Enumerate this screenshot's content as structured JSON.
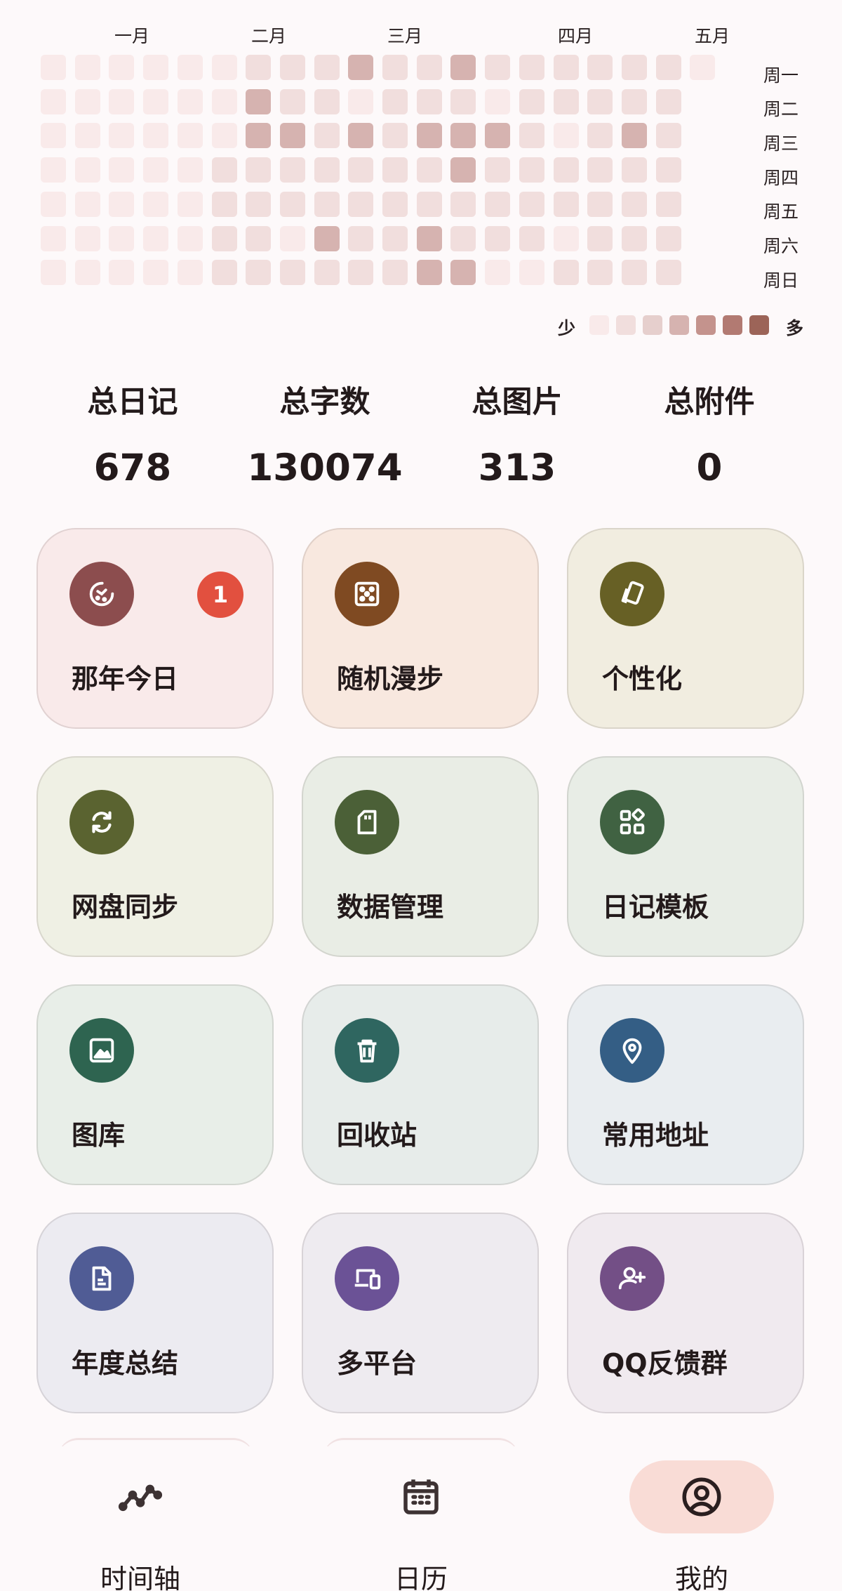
{
  "heatmap": {
    "months": [
      "一月",
      "二月",
      "三月",
      "四月",
      "五月"
    ],
    "weekdays": [
      "周一",
      "周二",
      "周三",
      "周四",
      "周五",
      "周六",
      "周日"
    ],
    "legend_low": "少",
    "legend_high": "多",
    "levels": [
      "#f9eaea",
      "#f1dedd",
      "#e6cfcd",
      "#d6b3b0",
      "#c4938d",
      "#b27a72",
      "#9c6458"
    ],
    "weeks": [
      [
        0,
        0,
        0,
        0,
        0,
        0,
        0
      ],
      [
        0,
        0,
        0,
        0,
        0,
        0,
        0
      ],
      [
        0,
        0,
        0,
        0,
        0,
        0,
        0
      ],
      [
        0,
        0,
        0,
        0,
        0,
        0,
        0
      ],
      [
        0,
        0,
        0,
        0,
        0,
        0,
        0
      ],
      [
        0,
        0,
        0,
        1,
        1,
        1,
        1
      ],
      [
        1,
        3,
        3,
        1,
        1,
        1,
        1
      ],
      [
        1,
        1,
        3,
        1,
        1,
        0,
        1
      ],
      [
        1,
        1,
        1,
        1,
        1,
        3,
        1
      ],
      [
        3,
        0,
        3,
        1,
        1,
        1,
        1
      ],
      [
        1,
        1,
        1,
        1,
        1,
        1,
        1
      ],
      [
        1,
        1,
        3,
        1,
        1,
        3,
        3
      ],
      [
        3,
        1,
        3,
        3,
        1,
        1,
        3
      ],
      [
        1,
        0,
        3,
        1,
        1,
        1,
        0
      ],
      [
        1,
        1,
        1,
        1,
        1,
        1,
        0
      ],
      [
        1,
        1,
        0,
        1,
        1,
        0,
        1
      ],
      [
        1,
        1,
        1,
        1,
        1,
        1,
        1
      ],
      [
        1,
        1,
        3,
        1,
        1,
        1,
        1
      ],
      [
        1,
        1,
        1,
        1,
        1,
        1,
        1
      ],
      [
        0,
        null,
        null,
        null,
        null,
        null,
        null
      ]
    ]
  },
  "stats": [
    {
      "label": "总日记",
      "value": "678"
    },
    {
      "label": "总字数",
      "value": "130074"
    },
    {
      "label": "总图片",
      "value": "313"
    },
    {
      "label": "总附件",
      "value": "0"
    }
  ],
  "cards": [
    {
      "label": "那年今日",
      "icon": "history-icon",
      "bg": "#f9eaea",
      "iconbg": "#8c4d4e",
      "badge": "1"
    },
    {
      "label": "随机漫步",
      "icon": "dice-icon",
      "bg": "#f8e8df",
      "iconbg": "#7f4a22"
    },
    {
      "label": "个性化",
      "icon": "cards-icon",
      "bg": "#f1ede0",
      "iconbg": "#676025"
    },
    {
      "label": "网盘同步",
      "icon": "sync-icon",
      "bg": "#eff0e4",
      "iconbg": "#5a6330"
    },
    {
      "label": "数据管理",
      "icon": "sd-card-icon",
      "bg": "#e9ede5",
      "iconbg": "#4b6037"
    },
    {
      "label": "日记模板",
      "icon": "widgets-icon",
      "bg": "#e8ede6",
      "iconbg": "#406242"
    },
    {
      "label": "图库",
      "icon": "image-icon",
      "bg": "#e8eee8",
      "iconbg": "#2e6450"
    },
    {
      "label": "回收站",
      "icon": "trash-icon",
      "bg": "#e7ecea",
      "iconbg": "#2f6660"
    },
    {
      "label": "常用地址",
      "icon": "location-icon",
      "bg": "#e9edf0",
      "iconbg": "#345e85"
    },
    {
      "label": "年度总结",
      "icon": "document-icon",
      "bg": "#ecebf1",
      "iconbg": "#505c95"
    },
    {
      "label": "多平台",
      "icon": "devices-icon",
      "bg": "#eeebf0",
      "iconbg": "#6b5296"
    },
    {
      "label": "QQ反馈群",
      "icon": "add-user-icon",
      "bg": "#f0eaef",
      "iconbg": "#734f86"
    }
  ],
  "nav": [
    {
      "label": "时间轴",
      "icon": "timeline-icon",
      "active": false
    },
    {
      "label": "日历",
      "icon": "calendar-icon",
      "active": false
    },
    {
      "label": "我的",
      "icon": "account-icon",
      "active": true
    }
  ]
}
